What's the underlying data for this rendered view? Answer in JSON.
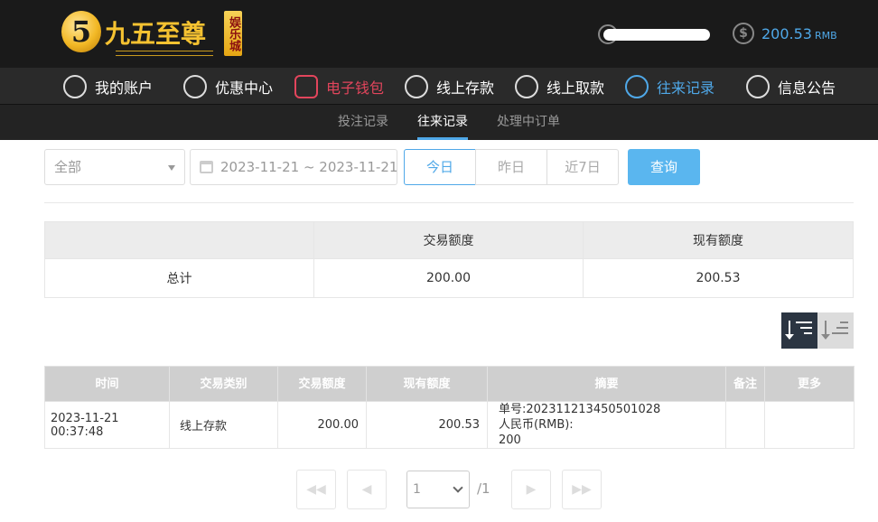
{
  "brand": {
    "mark": "5",
    "name": "九五至尊",
    "tag": "娱乐城"
  },
  "account": {
    "balance": "200.53",
    "unit": "RMB"
  },
  "nav": {
    "items": [
      {
        "label": "我的账户",
        "icon": "user-icon"
      },
      {
        "label": "优惠中心",
        "icon": "gift-icon"
      },
      {
        "label": "电子钱包",
        "icon": "wallet-icon"
      },
      {
        "label": "线上存款",
        "icon": "deposit-icon"
      },
      {
        "label": "线上取款",
        "icon": "withdraw-icon"
      },
      {
        "label": "往来记录",
        "icon": "records-icon"
      },
      {
        "label": "信息公告",
        "icon": "bell-icon"
      }
    ],
    "colors": {
      "active_red": "#e2455c",
      "active_blue": "#4fa8e8"
    }
  },
  "subnav": {
    "items": [
      "投注记录",
      "往来记录",
      "处理中订单"
    ],
    "active": "往来记录"
  },
  "filters": {
    "category": "全部",
    "date_range": "2023-11-21 ~ 2023-11-21",
    "quick": [
      "今日",
      "昨日",
      "近7日"
    ],
    "query_label": "查询"
  },
  "summary": {
    "headers": [
      "",
      "交易额度",
      "现有额度"
    ],
    "row": [
      "总计",
      "200.00",
      "200.53"
    ]
  },
  "records": {
    "headers": [
      "时间",
      "交易类别",
      "交易额度",
      "现有额度",
      "摘要",
      "备注",
      "更多"
    ],
    "rows": [
      {
        "time": "2023-11-21 00:37:48",
        "type": "线上存款",
        "amount": "200.00",
        "balance": "200.53",
        "summary_line1": "单号:202311213450501028",
        "summary_line2": "人民币(RMB):",
        "summary_line3": "200",
        "note": "",
        "more": ""
      }
    ]
  },
  "pagination": {
    "page": "1",
    "total": "/1"
  }
}
